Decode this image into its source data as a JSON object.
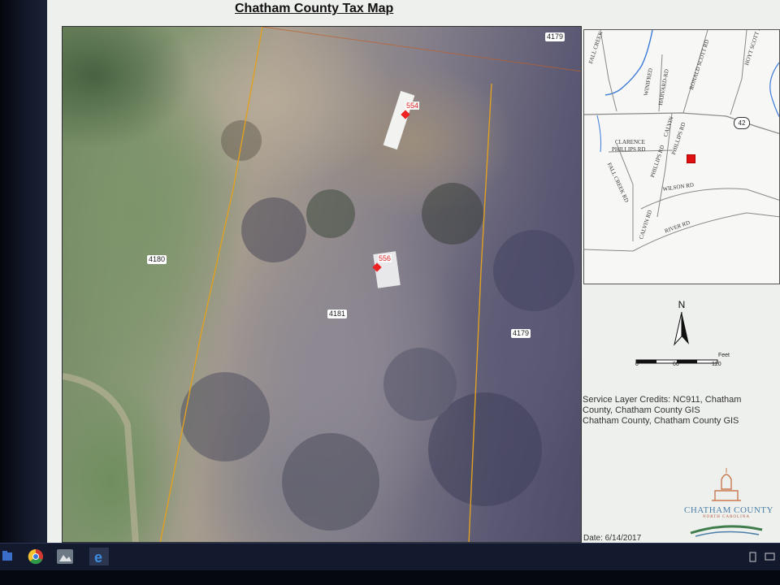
{
  "title": "Chatham County Tax Map",
  "parcels": {
    "p4179_top": "4179",
    "p4180": "4180",
    "p4181": "4181",
    "p4179_mid": "4179"
  },
  "addresses": {
    "a554": "554",
    "a556": "556"
  },
  "locator_map": {
    "roads": {
      "fall_creek_church": "FALL CREEK CHURCH RD",
      "winifred": "WINIFRED",
      "harvard_ridge": "HARVARD-RD",
      "ronald_scott": "RONALD SCOTT RD",
      "hoyt_scott": "HOYT SCOTT RD",
      "hwy": "42",
      "clarence": "CLARENCE",
      "phillips": "PHILLIPS RD",
      "calvin1": "CALVIN",
      "phillips2": "PHILLIPS RD",
      "fall_creek": "FALL CREEK RD",
      "phillips3": "PHILLIPS RD",
      "wilson": "WILSON RD",
      "calvin2": "CALVIN RD",
      "river": "RIVER RD"
    }
  },
  "north": "N",
  "scale": {
    "unit": "Feet",
    "t0": "0",
    "t1": "60",
    "t2": "120"
  },
  "credits": {
    "line1": "Service Layer Credits: NC911, Chatham",
    "line2": "County, Chatham County GIS",
    "line3": "Chatham County, Chatham County GIS"
  },
  "logo": {
    "name": "CHATHAM COUNTY",
    "sub": "NORTH CAROLINA"
  },
  "date": "Date: 6/14/2017",
  "taskbar": {
    "icons": [
      "file-explorer-icon",
      "chrome-icon",
      "photos-icon",
      "edge-icon"
    ]
  },
  "colors": {
    "subject_marker": "#e01010",
    "address_label": "#d22222",
    "parcel_line": "#e0a020",
    "title": "#111111",
    "logo_blue": "#4a7ea8"
  }
}
